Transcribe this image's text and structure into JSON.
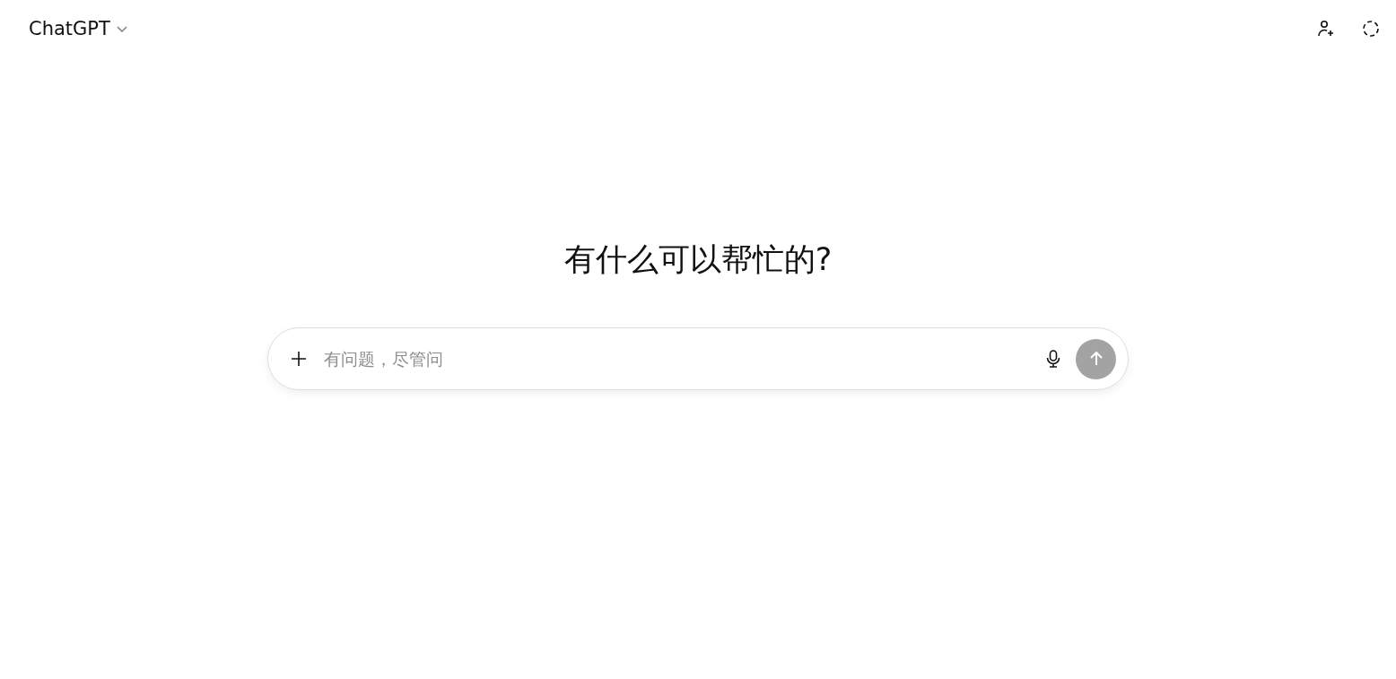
{
  "header": {
    "title": "ChatGPT"
  },
  "heading": "有什么可以帮忙的?",
  "composer": {
    "placeholder": "有问题，尽管问",
    "send_disabled": true
  }
}
